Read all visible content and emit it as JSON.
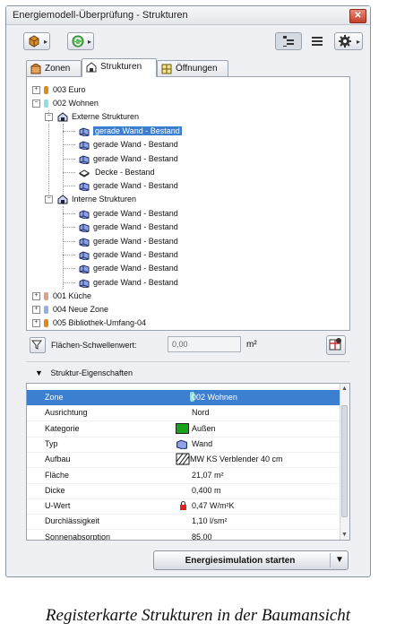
{
  "window": {
    "title": "Energiemodell-Überprüfung - Strukturen",
    "close_glyph": "✕"
  },
  "tabs": [
    {
      "label": "Zonen"
    },
    {
      "label": "Strukturen"
    },
    {
      "label": "Öffnungen"
    }
  ],
  "tree": {
    "zone_003": "003 Euro",
    "zone_002": "002 Wohnen",
    "ext_group": "Externe Strukturen",
    "int_group": "Interne Strukturen",
    "ext_items": [
      "gerade Wand - Bestand",
      "gerade Wand - Bestand",
      "gerade Wand - Bestand",
      "Decke - Bestand",
      "gerade Wand - Bestand"
    ],
    "int_items": [
      "gerade Wand - Bestand",
      "gerade Wand - Bestand",
      "gerade Wand - Bestand",
      "gerade Wand - Bestand",
      "gerade Wand - Bestand",
      "gerade Wand - Bestand"
    ],
    "zone_001": "001 Küche",
    "zone_004": "004 Neue Zone",
    "zone_005": "005 Bibliothek-Umfang-04"
  },
  "filter": {
    "label": "Flächen-Schwellenwert:",
    "value": "0,00",
    "unit": "m²"
  },
  "section_title": "Struktur-Eigenschaften",
  "properties": [
    {
      "name": "Zone",
      "value": "002 Wohnen"
    },
    {
      "name": "Ausrichtung",
      "value": "Nord"
    },
    {
      "name": "Kategorie",
      "value": "Außen"
    },
    {
      "name": "Typ",
      "value": "Wand"
    },
    {
      "name": "Aufbau",
      "value": "MW KS Verblender 40 cm"
    },
    {
      "name": "Fläche",
      "value": "21,07 m²"
    },
    {
      "name": "Dicke",
      "value": "0,400 m"
    },
    {
      "name": "U-Wert",
      "value": "0,47 W/m²K"
    },
    {
      "name": "Durchlässigkeit",
      "value": "1,10 l/sm²"
    },
    {
      "name": "Sonnenabsorption",
      "value": "85,00"
    }
  ],
  "start_button": "Energiesimulation starten",
  "caption": "Registerkarte Strukturen in der Baumansicht",
  "colors": {
    "selection": "#3c7fd1",
    "zone_euro": "#e08a1e",
    "zone_wohnen": "#8fe0df",
    "zone_kueche": "#e0a089",
    "zone_neu": "#8fb3e0",
    "zone_bib": "#e08a1e",
    "kategorie_aussen": "#19a219"
  }
}
